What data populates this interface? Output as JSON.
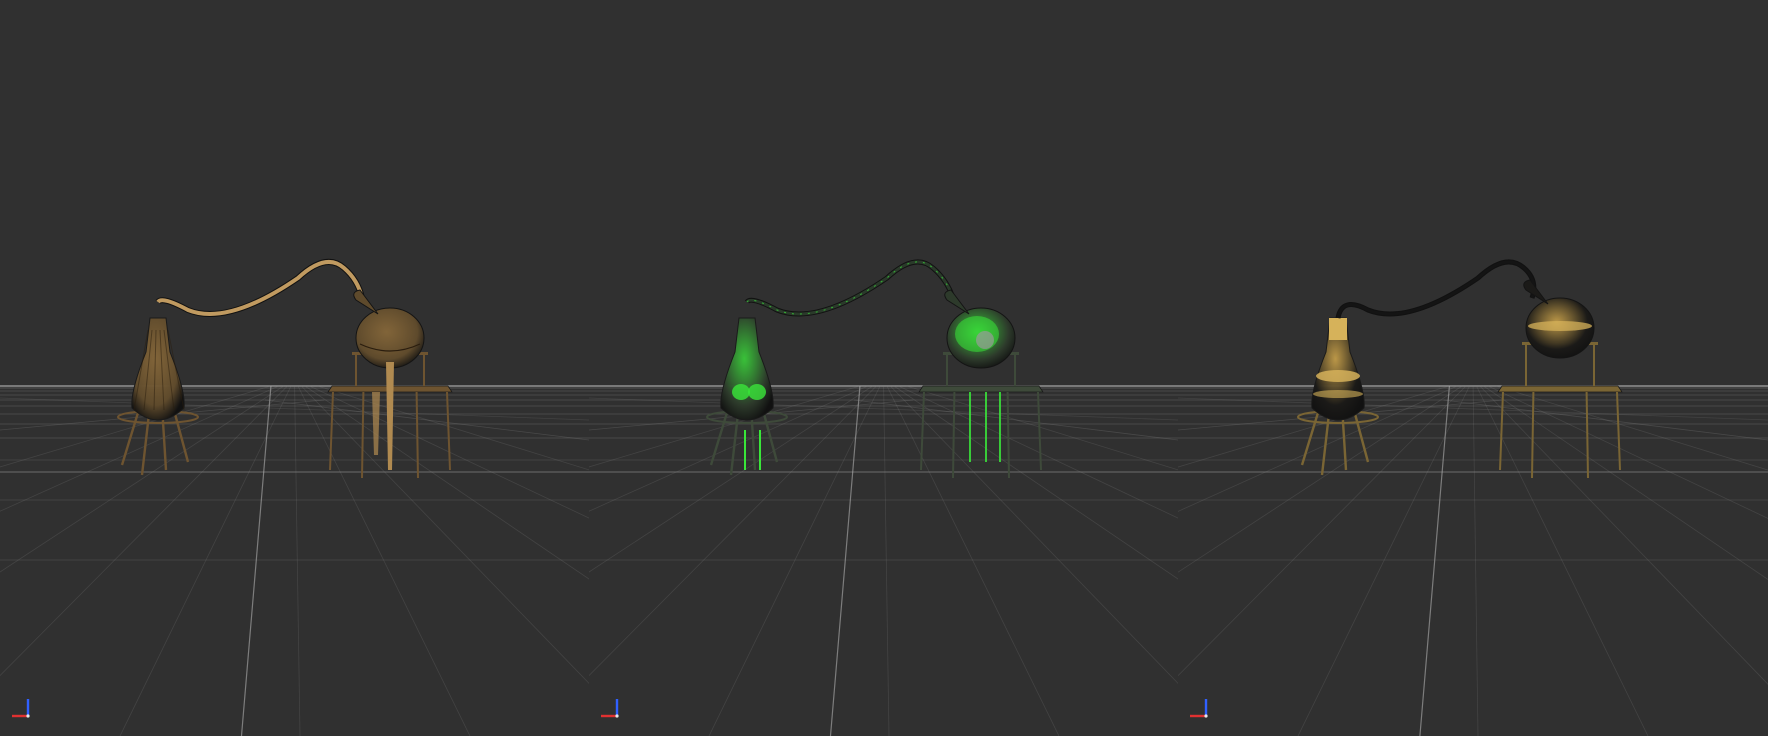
{
  "viewport": {
    "background": "#303030",
    "grid_color": "#8a8a8a",
    "panels": [
      {
        "name": "wood-variant",
        "flask_color": "#5e4a2c",
        "flask_highlight": "#8a6a3a",
        "tube_color": "#c09a60",
        "stand_color": "#6e5430",
        "accent_color": "#b08a50"
      },
      {
        "name": "green-variant",
        "flask_color": "#2d3a2b",
        "flask_highlight": "#3ad13a",
        "tube_color": "#2a3a2a",
        "stand_color": "#3e4a3a",
        "accent_color": "#39e639"
      },
      {
        "name": "gold-variant",
        "flask_color": "#1b1a18",
        "flask_highlight": "#caa24a",
        "tube_color": "#141414",
        "stand_color": "#7a6534",
        "accent_color": "#d6b25a"
      }
    ],
    "gizmo": {
      "x_color": "#e03030",
      "y_color": "#3060ff",
      "z_color": "#e8e8e8"
    }
  }
}
